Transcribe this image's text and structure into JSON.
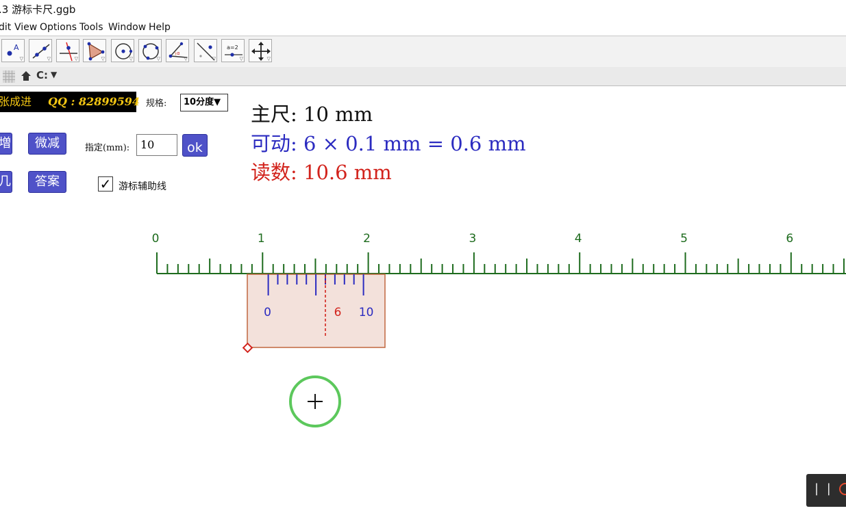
{
  "window": {
    "title": ".3 游标卡尺.ggb"
  },
  "menu": [
    "dit",
    "View",
    "Options",
    "Tools",
    "Window",
    "Help"
  ],
  "toolbar": {
    "tools": [
      "point-tool",
      "line-tool",
      "perpendicular-line-tool",
      "polygon-tool",
      "circle-center-point-tool",
      "circle-three-points-tool",
      "angle-tool",
      "reflect-tool",
      "slider-tool",
      "move-graphics-view-tool"
    ],
    "slider_tool_text": "a=2"
  },
  "stylebar": {
    "items": [
      "grid-icon",
      "home-icon",
      "undo-icon",
      "dropdown-arrow-icon"
    ],
    "undo_text": "C:"
  },
  "controls": {
    "author_cn": "张成进",
    "author_qq": "QQ : 82899594",
    "spec_label": "规格:",
    "spec_value": "10分度▼",
    "increase_label": "増",
    "decrease_label": "微减",
    "specify_label": "指定(mm):",
    "specify_value": "10",
    "ok_label": "ok",
    "random_label": "几",
    "answer_label": "答案",
    "aux_line_checked": true,
    "aux_line_label": "游标辅助线"
  },
  "readout": {
    "main": "主尺: 10 mm",
    "vernier": "可动: 6 × 0.1 mm = 0.6 mm",
    "reading": "读数: 10.6 mm"
  },
  "main_scale": {
    "labels": [
      "0",
      "1",
      "2",
      "3",
      "4",
      "5",
      "6"
    ],
    "unit": "cm",
    "color": "#1d6b1d"
  },
  "vernier": {
    "labels": [
      "0",
      "6",
      "10"
    ],
    "aligned_division": 6,
    "divisions": 10,
    "tick_color": "#2b2bc0",
    "body_fill": "#f3e1db",
    "body_stroke": "#c0663f",
    "marker_color": "#d2231c"
  },
  "move_button": {
    "icon": "plus-icon",
    "ring_color": "#5cc85c"
  },
  "recording": {
    "pause_text": "| |"
  },
  "colors": {
    "accent_button": "#4f52c8",
    "author_text": "#f3c613"
  }
}
